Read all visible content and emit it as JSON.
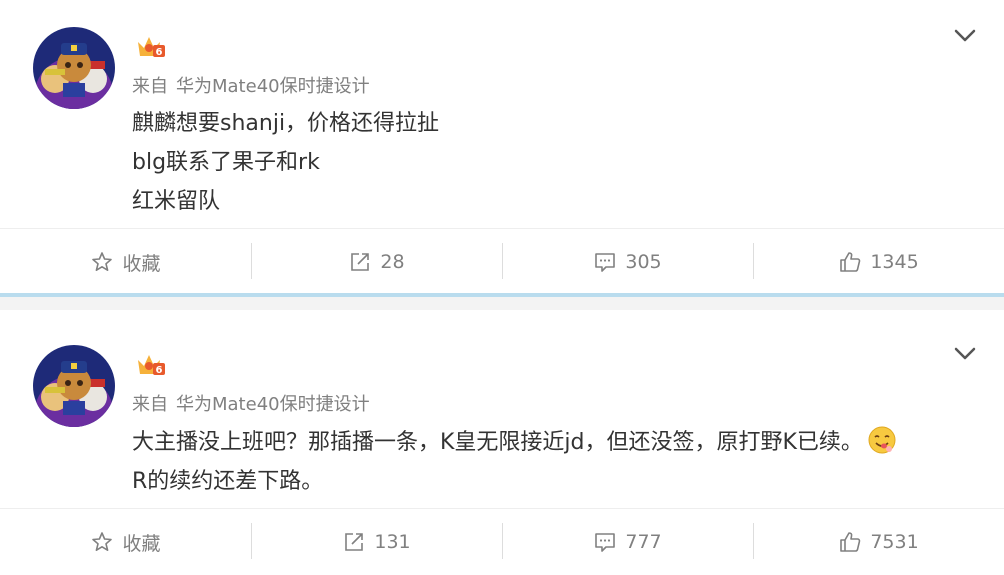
{
  "posts": [
    {
      "source_prefix": "来自",
      "source_device": "华为Mate40保时捷设计",
      "content_lines": [
        "麒麟想要shanji，价格还得拉扯",
        "blg联系了果子和rk",
        "红米留队"
      ],
      "actions": {
        "favorite": "收藏",
        "repost": "28",
        "comment": "305",
        "like": "1345"
      }
    },
    {
      "source_prefix": "来自",
      "source_device": "华为Mate40保时捷设计",
      "content_lines": [
        "大主播没上班吧？那插播一条，K皇无限接近jd，但还没签，原打野K已续。",
        "R的续约还差下路。"
      ],
      "actions": {
        "favorite": "收藏",
        "repost": "131",
        "comment": "777",
        "like": "7531"
      }
    }
  ],
  "colors": {
    "separator": "#b9dcee",
    "meta_text": "#808080",
    "body_text": "#333333",
    "badge": "#f6b13a"
  },
  "icons": [
    "star-icon",
    "repost-icon",
    "comment-icon",
    "like-icon",
    "chevron-down-icon",
    "vip-crown-badge-icon",
    "yum-emoji-icon"
  ]
}
